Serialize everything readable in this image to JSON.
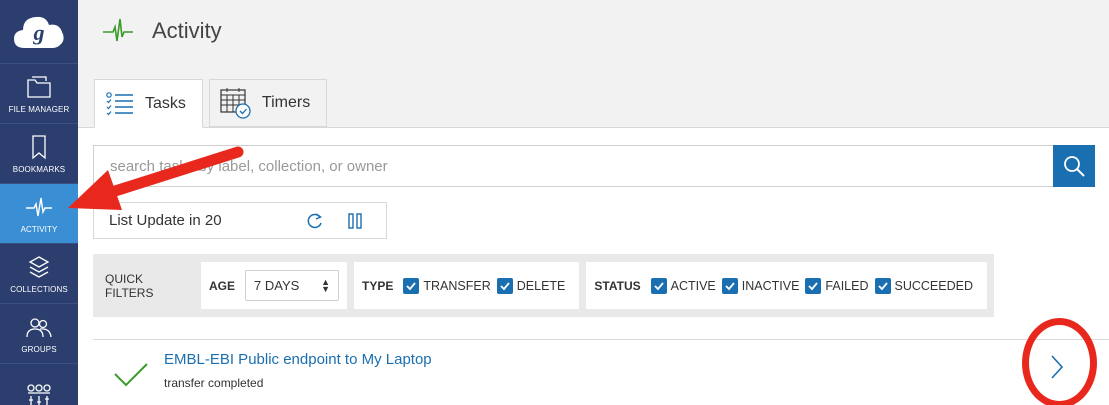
{
  "sidebar": {
    "logo_icon": "globus-cloud-logo",
    "items": [
      {
        "label": "FILE MANAGER",
        "icon": "folder-icon"
      },
      {
        "label": "BOOKMARKS",
        "icon": "bookmark-icon"
      },
      {
        "label": "ACTIVITY",
        "icon": "activity-pulse-icon",
        "active": true
      },
      {
        "label": "COLLECTIONS",
        "icon": "layers-icon"
      },
      {
        "label": "GROUPS",
        "icon": "people-icon"
      }
    ]
  },
  "header": {
    "title": "Activity",
    "icon": "activity-pulse-icon"
  },
  "tabs": [
    {
      "label": "Tasks",
      "icon": "task-list-icon",
      "active": true
    },
    {
      "label": "Timers",
      "icon": "calendar-clock-icon",
      "active": false
    }
  ],
  "search": {
    "placeholder": "search tasks by label, collection, or owner",
    "button_icon": "search-icon"
  },
  "list_update": {
    "label": "List Update in 20",
    "refresh_icon": "refresh-icon",
    "pause_icon": "pause-icon"
  },
  "quick_filters": {
    "label": "QUICK FILTERS",
    "age": {
      "label": "AGE",
      "selected": "7 DAYS"
    },
    "type": {
      "label": "TYPE",
      "options": [
        {
          "label": "TRANSFER",
          "checked": true
        },
        {
          "label": "DELETE",
          "checked": true
        }
      ]
    },
    "status": {
      "label": "STATUS",
      "options": [
        {
          "label": "ACTIVE",
          "checked": true
        },
        {
          "label": "INACTIVE",
          "checked": true
        },
        {
          "label": "FAILED",
          "checked": true
        },
        {
          "label": "SUCCEEDED",
          "checked": true
        }
      ]
    }
  },
  "tasks": [
    {
      "title": "EMBL-EBI Public endpoint to My Laptop",
      "status": "transfer completed",
      "status_icon": "checkmark-icon"
    }
  ],
  "colors": {
    "sidebar": "#2c3e6e",
    "sidebar_active": "#3a8fd4",
    "link": "#1a6fb0",
    "success": "#3a9b2a",
    "annotation": "#e8281c"
  }
}
